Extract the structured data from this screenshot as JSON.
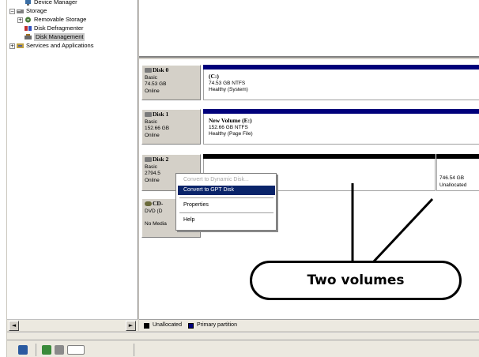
{
  "tree": {
    "items": [
      {
        "label": "Device Manager",
        "icon": "device-manager-icon"
      },
      {
        "label": "Storage",
        "icon": "storage-icon",
        "expander": "−"
      },
      {
        "label": "Removable Storage",
        "icon": "removable-storage-icon",
        "expander": "+"
      },
      {
        "label": "Disk Defragmenter",
        "icon": "defragmenter-icon"
      },
      {
        "label": "Disk Management",
        "icon": "disk-management-icon",
        "selected": true
      },
      {
        "label": "Services and Applications",
        "icon": "services-icon",
        "expander": "+"
      }
    ],
    "scroll_left": "◄",
    "scroll_right": "►"
  },
  "disks": [
    {
      "name": "Disk 0",
      "type": "Basic",
      "size": "74.53 GB",
      "status": "Online",
      "partitions": [
        {
          "volume": "(C:)",
          "detail": "74.53 GB NTFS",
          "health": "Healthy (System)",
          "bar_color": "#00007b"
        }
      ]
    },
    {
      "name": "Disk 1",
      "type": "Basic",
      "size": "152.66 GB",
      "status": "Online",
      "partitions": [
        {
          "volume": "New Volume  (E:)",
          "detail": "152.66 GB NTFS",
          "health": "Healthy (Page File)",
          "bar_color": "#00007b"
        }
      ]
    },
    {
      "name": "Disk 2",
      "type": "Basic",
      "size": "2794.5",
      "status": "Online",
      "partitions": [
        {
          "volume": "",
          "detail": "",
          "health": "",
          "bar_color": "#000000"
        },
        {
          "volume": "",
          "detail": "746.54 GB",
          "health": "Unallocated",
          "bar_color": "#000000"
        }
      ]
    },
    {
      "name": "CD-",
      "type": "DVD (D",
      "size": "",
      "status": "No Media"
    }
  ],
  "context_menu": {
    "items": [
      {
        "label": "Convert to Dynamic Disk...",
        "disabled": true
      },
      {
        "label": "Convert to GPT Disk",
        "highlighted": true
      },
      {
        "label": "Properties"
      },
      {
        "label": "Help"
      }
    ]
  },
  "legend": {
    "unallocated_label": "Unallocated",
    "unallocated_color": "#000000",
    "primary_label": "Primary partition",
    "primary_color": "#00007b"
  },
  "callout": {
    "text": "Two volumes"
  }
}
